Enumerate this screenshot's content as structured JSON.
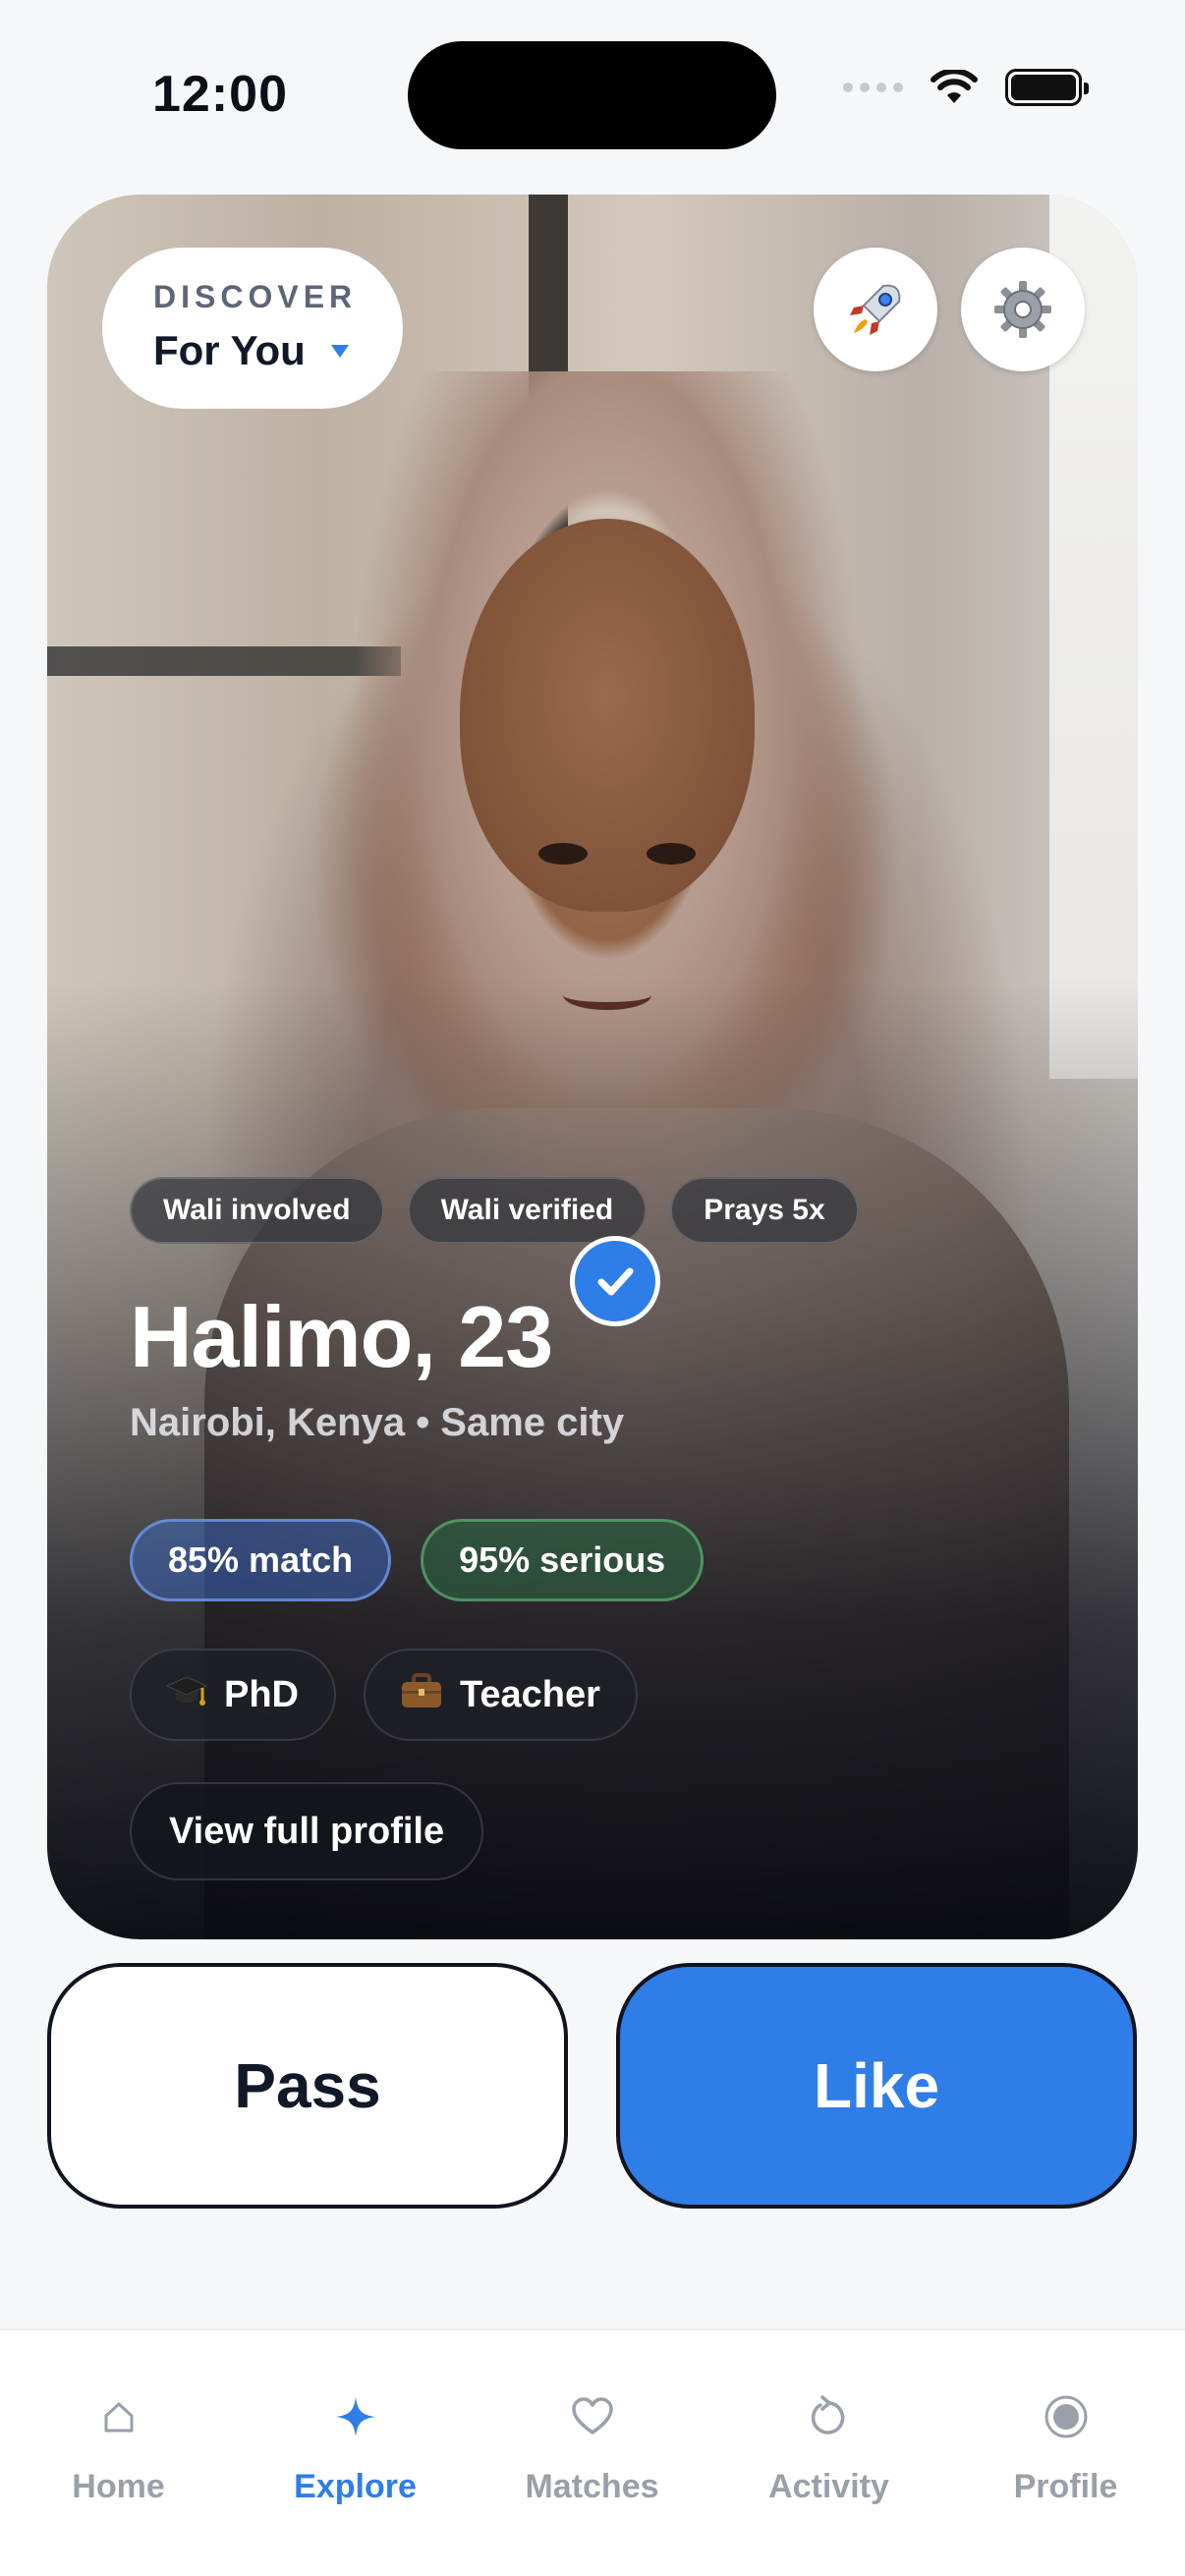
{
  "status_bar": {
    "time": "12:00"
  },
  "header": {
    "discover_label": "DISCOVER",
    "discover_value": "For You",
    "boost_icon": "rocket-icon",
    "settings_icon": "gear-icon"
  },
  "profile": {
    "tags": [
      "Wali involved",
      "Wali verified",
      "Prays 5x"
    ],
    "name_age": "Halimo, 23",
    "verified_icon": "checkmark-icon",
    "location": "Nairobi, Kenya • Same city",
    "match": "85% match",
    "serious": "95% serious",
    "education": {
      "icon": "graduation-cap-icon",
      "label": "PhD"
    },
    "job": {
      "icon": "briefcase-icon",
      "label": "Teacher"
    },
    "view_profile": "View full profile"
  },
  "actions": {
    "pass": "Pass",
    "like": "Like"
  },
  "tabs": [
    {
      "label": "Home",
      "icon": "house-icon",
      "active": false
    },
    {
      "label": "Explore",
      "icon": "sparkle-icon",
      "active": true
    },
    {
      "label": "Matches",
      "icon": "heart-icon",
      "active": false
    },
    {
      "label": "Activity",
      "icon": "refresh-icon",
      "active": false
    },
    {
      "label": "Profile",
      "icon": "profile-circle-icon",
      "active": false
    }
  ],
  "colors": {
    "accent": "#2f7de6",
    "background": "#f6f7f9",
    "inactive_tab": "#9aa0aa"
  }
}
